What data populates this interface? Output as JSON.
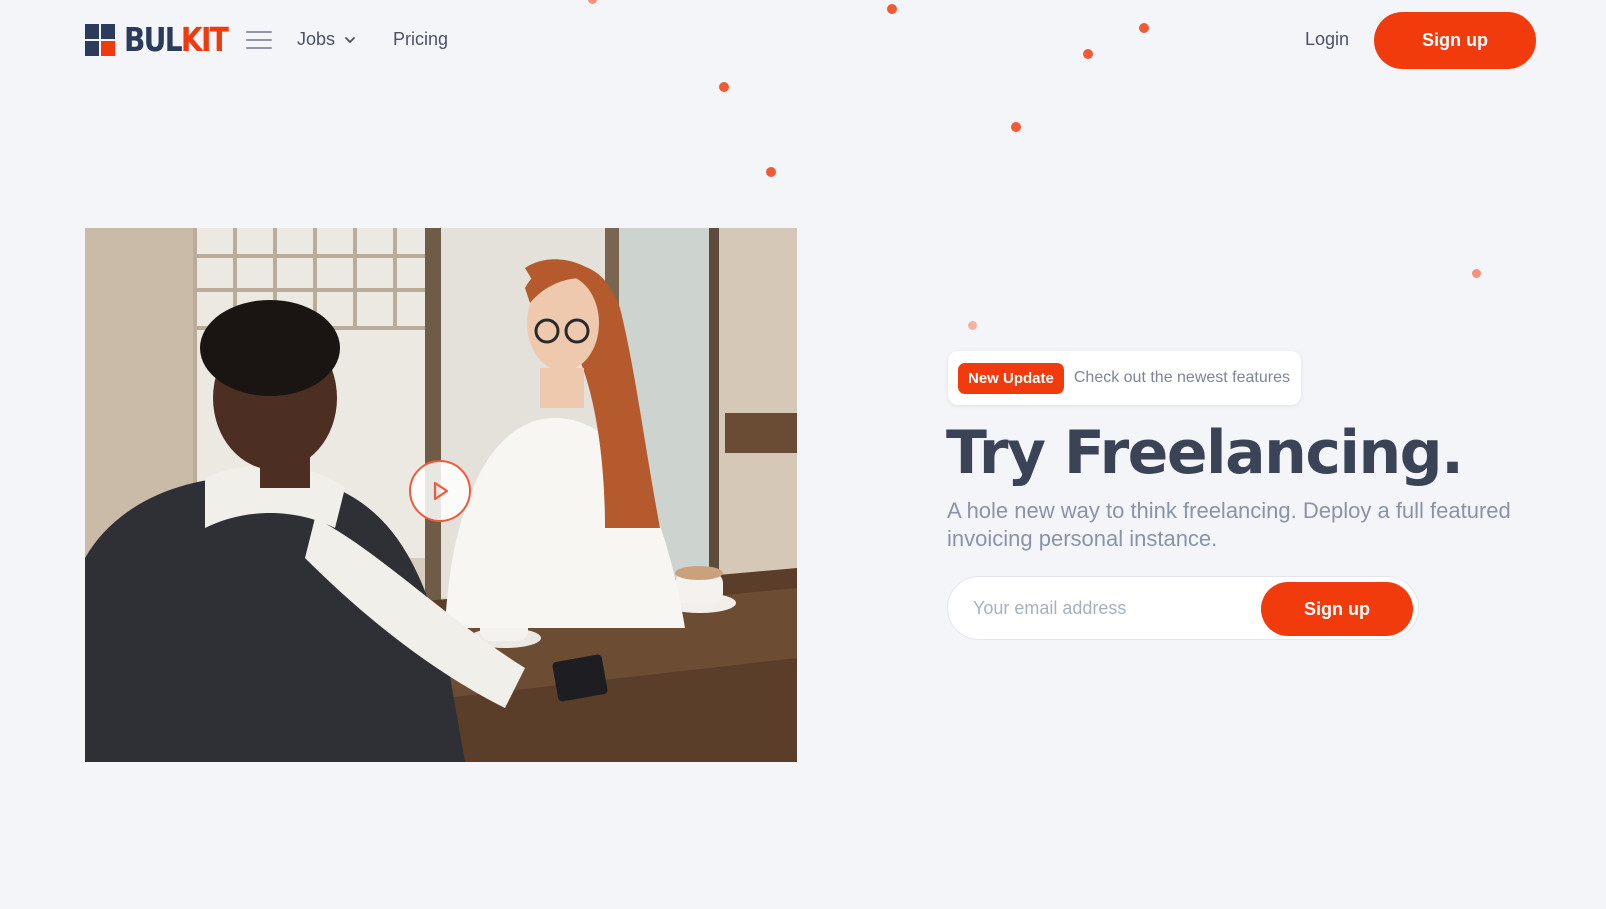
{
  "brand": {
    "logo_part1": "BUL",
    "logo_part2": "KIT",
    "primary_color": "#f23b0c",
    "dark_color": "#2a3b5c"
  },
  "nav": {
    "menu_icon": "hamburger-icon",
    "items": [
      {
        "label": "Jobs",
        "has_dropdown": true,
        "dropdown_icon": "chevron-down-icon"
      },
      {
        "label": "Pricing",
        "has_dropdown": false
      }
    ],
    "login_label": "Login",
    "signup_label": "Sign up"
  },
  "hero": {
    "image_icon": "play-icon",
    "badge": {
      "label": "New Update",
      "text": "Check out the newest features"
    },
    "title": "Try Freelancing.",
    "subtitle": "A hole new way to think freelancing. Deploy a full featured invoicing personal instance.",
    "form": {
      "email_placeholder": "Your email address",
      "email_value": "",
      "submit_label": "Sign up"
    }
  }
}
